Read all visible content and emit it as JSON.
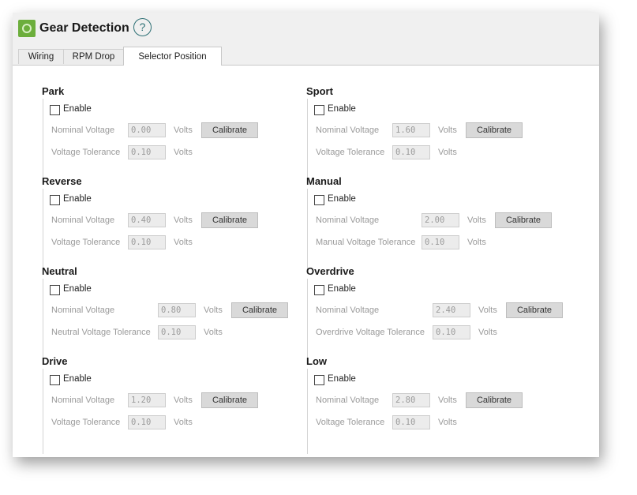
{
  "window": {
    "title": "Gear Detection",
    "help_label": "?"
  },
  "tabs": [
    {
      "label": "Wiring"
    },
    {
      "label": "RPM Drop"
    },
    {
      "label": "Selector Position"
    }
  ],
  "common": {
    "enable": "Enable",
    "nominal": "Nominal Voltage",
    "volts": "Volts",
    "calibrate": "Calibrate"
  },
  "sections": {
    "park": {
      "title": "Park",
      "nominal_value": "0.00",
      "tolerance_label": "Voltage Tolerance",
      "tolerance_value": "0.10"
    },
    "reverse": {
      "title": "Reverse",
      "nominal_value": "0.40",
      "tolerance_label": "Voltage Tolerance",
      "tolerance_value": "0.10"
    },
    "neutral": {
      "title": "Neutral",
      "nominal_value": "0.80",
      "tolerance_label": "Neutral Voltage Tolerance",
      "tolerance_value": "0.10"
    },
    "drive": {
      "title": "Drive",
      "nominal_value": "1.20",
      "tolerance_label": "Voltage Tolerance",
      "tolerance_value": "0.10"
    },
    "sport": {
      "title": "Sport",
      "nominal_value": "1.60",
      "tolerance_label": "Voltage Tolerance",
      "tolerance_value": "0.10"
    },
    "manual": {
      "title": "Manual",
      "nominal_value": "2.00",
      "tolerance_label": "Manual Voltage Tolerance",
      "tolerance_value": "0.10"
    },
    "overdrive": {
      "title": "Overdrive",
      "nominal_value": "2.40",
      "tolerance_label": "Overdrive Voltage Tolerance",
      "tolerance_value": "0.10"
    },
    "low": {
      "title": "Low",
      "nominal_value": "2.80",
      "tolerance_label": "Voltage Tolerance",
      "tolerance_value": "0.10"
    }
  }
}
